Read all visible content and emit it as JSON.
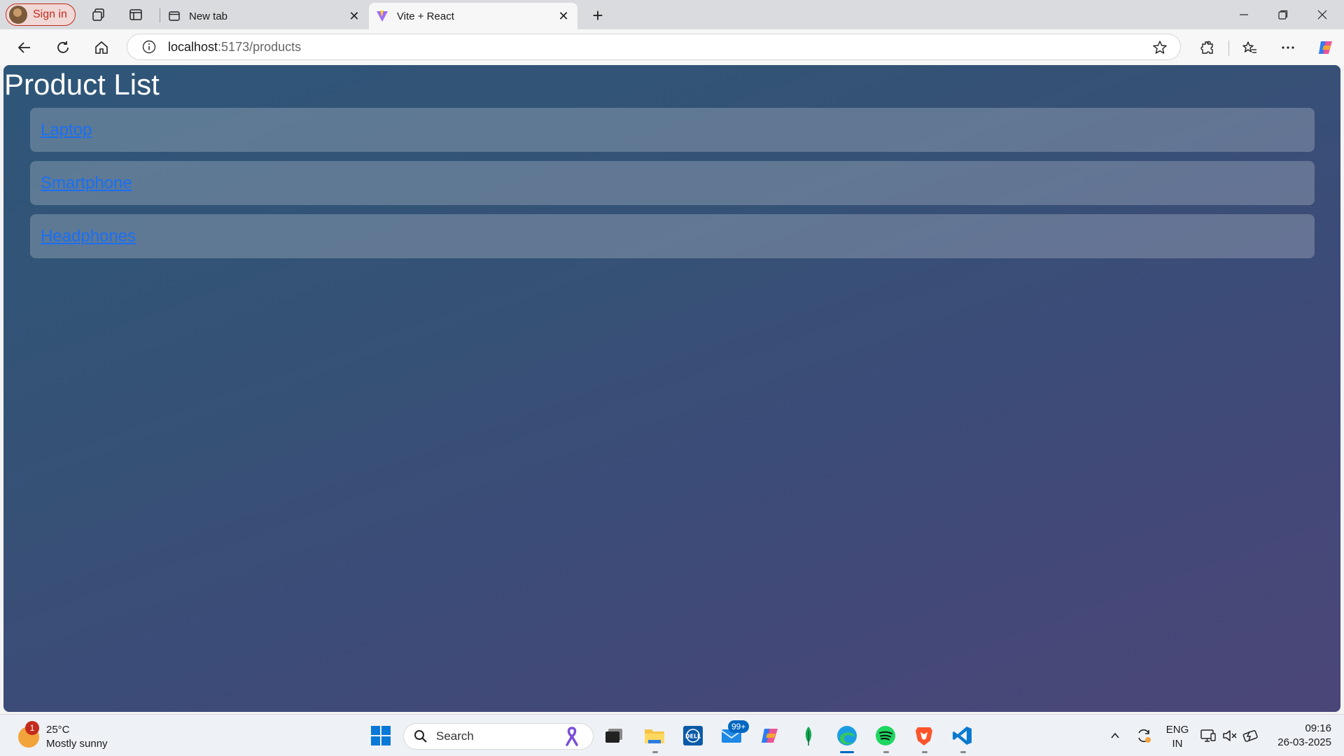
{
  "browser": {
    "signin_label": "Sign in",
    "tabs": [
      {
        "title": "New tab",
        "active": false,
        "favicon": "new-tab-icon"
      },
      {
        "title": "Vite + React",
        "active": true,
        "favicon": "vite-logo-icon"
      }
    ],
    "address": {
      "host": "localhost",
      "path": ":5173/products"
    }
  },
  "page": {
    "title": "Product List",
    "products": [
      {
        "name": "Laptop"
      },
      {
        "name": "Smartphone"
      },
      {
        "name": "Headphones"
      }
    ]
  },
  "taskbar": {
    "weather": {
      "temp": "25°C",
      "condition": "Mostly sunny",
      "badge": "1"
    },
    "search_label": "Search",
    "mail_badge": "99+",
    "language": {
      "line1": "ENG",
      "line2": "IN"
    },
    "clock": {
      "time": "09:16",
      "date": "26-03-2025"
    }
  },
  "colors": {
    "accent": "#0067c0",
    "link": "#1a6ff5",
    "signin": "#c42b1c"
  }
}
